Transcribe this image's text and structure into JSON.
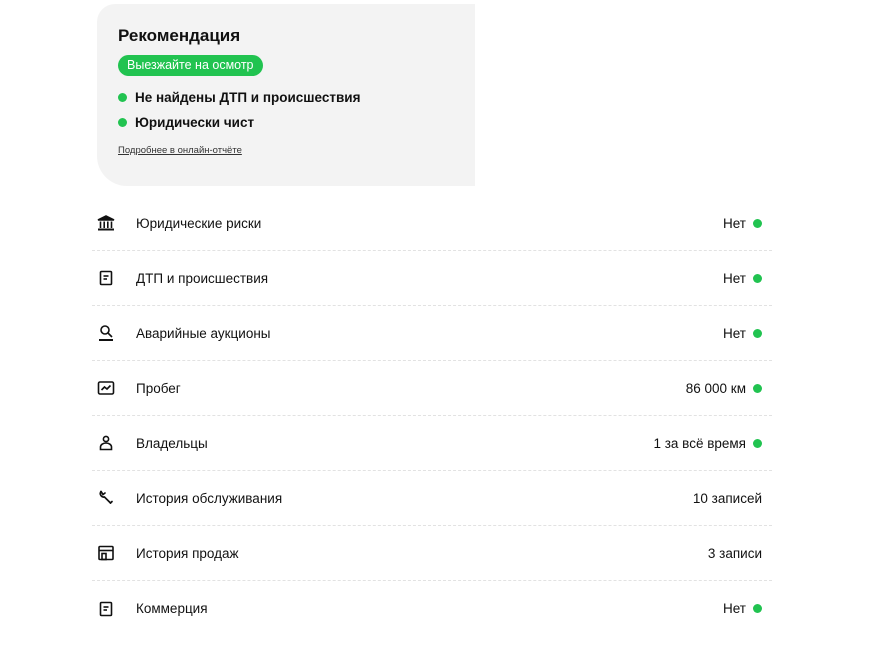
{
  "recommendation": {
    "title": "Рекомендация",
    "badge": "Выезжайте на осмотр",
    "facts": [
      "Не найдены ДТП и происшествия",
      "Юридически чист"
    ],
    "link": "Подробнее в онлайн-отчёте"
  },
  "colors": {
    "accent": "#21c350",
    "card_bg": "#f3f3f3"
  },
  "rows": [
    {
      "icon": "bank-icon",
      "label": "Юридические риски",
      "value": "Нет",
      "status": "ok"
    },
    {
      "icon": "document-icon",
      "label": "ДТП и происшествия",
      "value": "Нет",
      "status": "ok"
    },
    {
      "icon": "gavel-icon",
      "label": "Аварийные аукционы",
      "value": "Нет",
      "status": "ok"
    },
    {
      "icon": "chart-icon",
      "label": "Пробег",
      "value": "86 000 км",
      "status": "ok"
    },
    {
      "icon": "person-icon",
      "label": "Владельцы",
      "value": "1 за всё время",
      "status": "ok"
    },
    {
      "icon": "wrench-icon",
      "label": "История обслуживания",
      "value": "10 записей",
      "status": "none"
    },
    {
      "icon": "store-icon",
      "label": "История продаж",
      "value": "3 записи",
      "status": "none"
    },
    {
      "icon": "document-icon",
      "label": "Коммерция",
      "value": "Нет",
      "status": "ok"
    }
  ]
}
